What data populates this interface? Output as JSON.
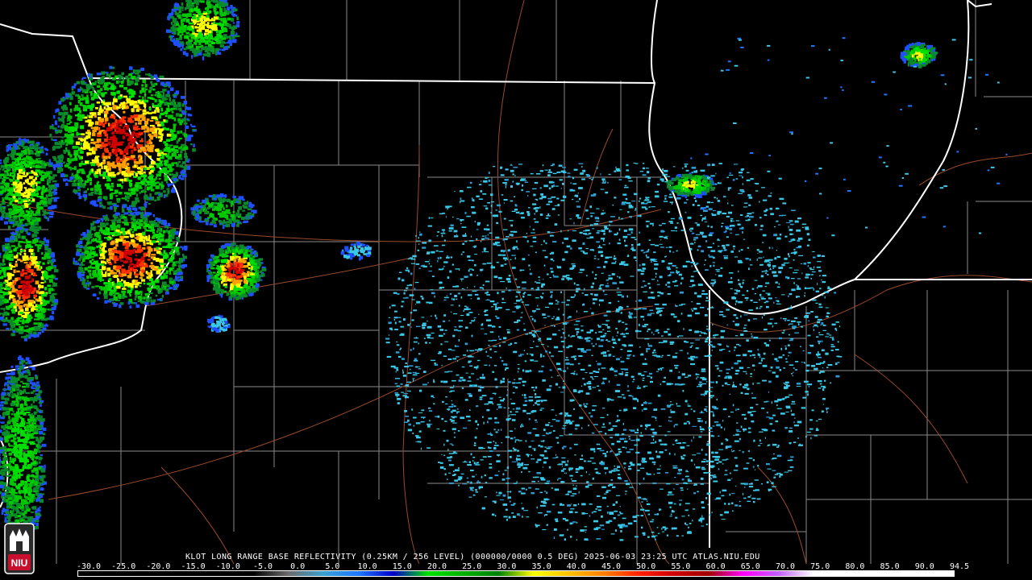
{
  "product": {
    "caption": "KLOT LONG RANGE BASE REFLECTIVITY (0.25KM / 256 LEVEL) (000000/0000 0.5 DEG) 2025-06-03 23:25 UTC  ATLAS.NIU.EDU"
  },
  "scale": {
    "labels": [
      "-30.0",
      "-25.0",
      "-20.0",
      "-15.0",
      "-10.0",
      "-5.0",
      "0.0",
      "5.0",
      "10.0",
      "15.0",
      "20.0",
      "25.0",
      "30.0",
      "35.0",
      "40.0",
      "45.0",
      "50.0",
      "55.0",
      "60.0",
      "65.0",
      "70.0",
      "75.0",
      "80.0",
      "85.0",
      "90.0",
      "94.5"
    ],
    "colors": [
      "#000000",
      "#000000",
      "#000000",
      "#000000",
      "#000000",
      "#000000",
      "#6a6a6a",
      "#3aa0d0",
      "#1e78ff",
      "#0000c8",
      "#00e000",
      "#00b000",
      "#008000",
      "#ffff00",
      "#ffc000",
      "#ff8000",
      "#ff2000",
      "#d00000",
      "#a00000",
      "#ff00ff",
      "#c060ff",
      "#ffffff",
      "#ffffff",
      "#ffffff",
      "#ffffff",
      "#ffffff"
    ]
  },
  "logo": {
    "text": "NIU",
    "color": "#c8102e"
  }
}
